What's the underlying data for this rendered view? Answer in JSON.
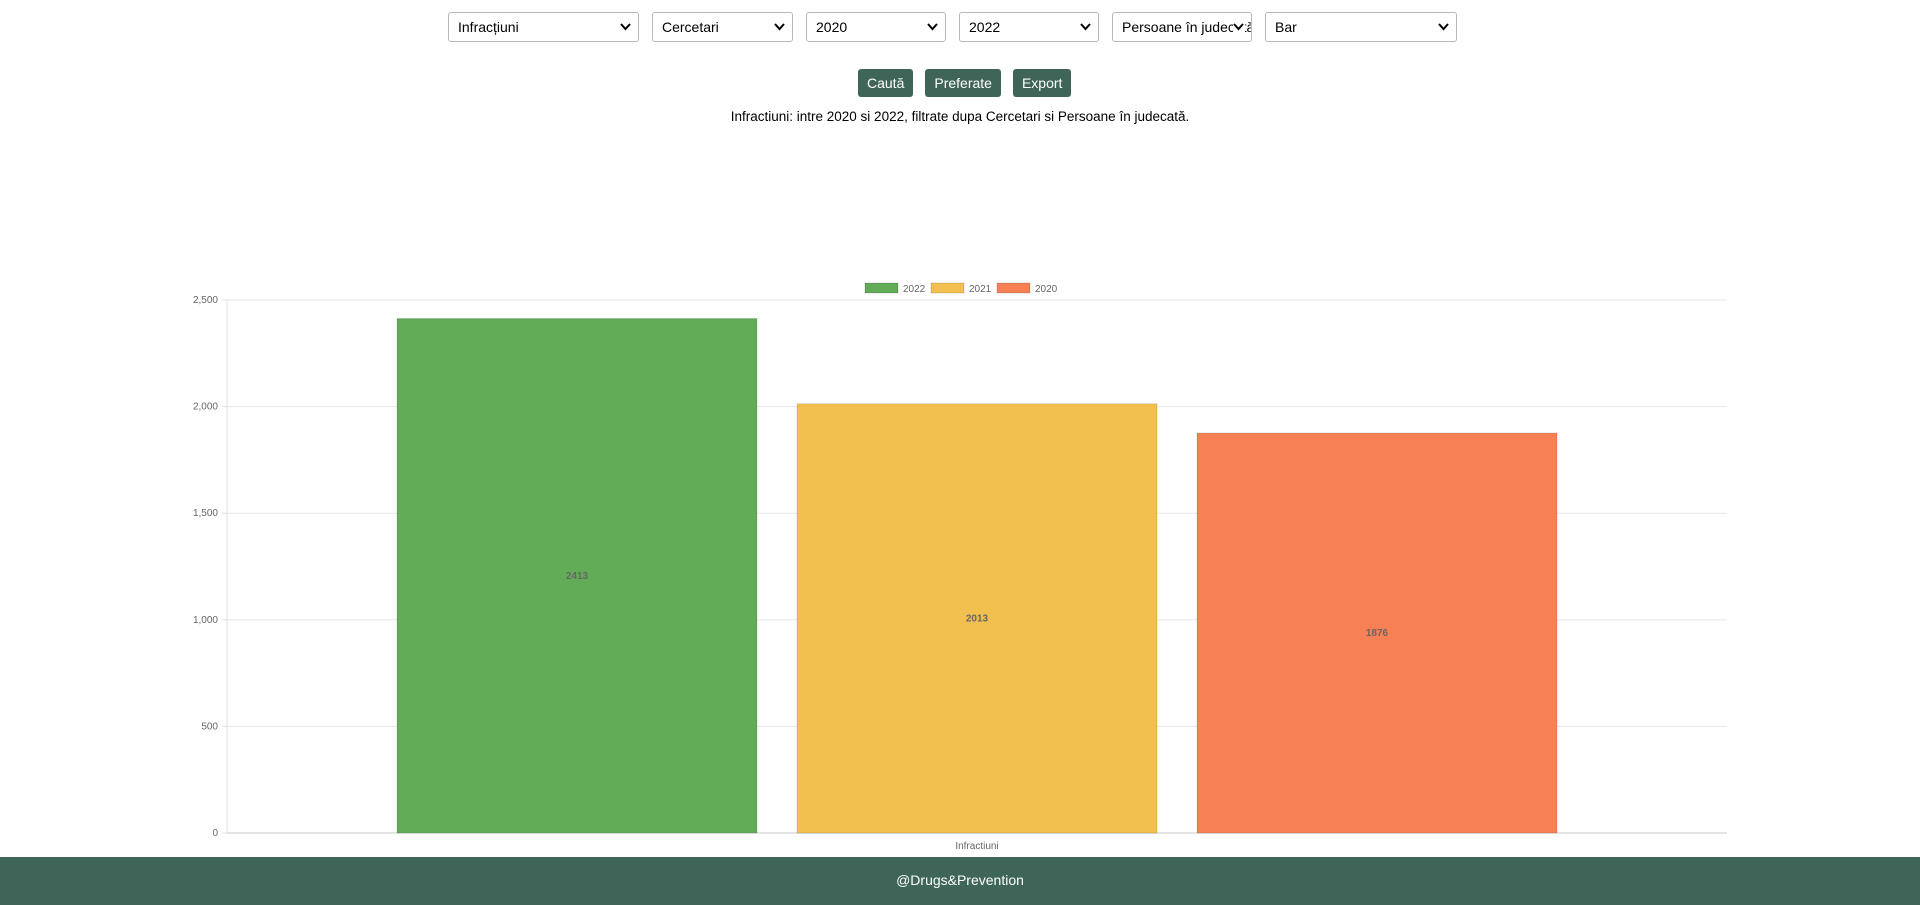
{
  "filters": {
    "category": "Infracțiuni",
    "stage": "Cercetari",
    "year_from": "2020",
    "year_to": "2022",
    "subject": "Persoane în judecată",
    "chart_type": "Bar"
  },
  "buttons": {
    "search": "Caută",
    "favorites": "Preferate",
    "export": "Export"
  },
  "caption": "Infractiuni: intre 2020 si 2022, filtrate dupa Cercetari si Persoane în judecată.",
  "footer": "@Drugs&Prevention",
  "chart_data": {
    "type": "bar",
    "categories": [
      "Infractiuni"
    ],
    "series": [
      {
        "name": "2022",
        "values": [
          2413
        ],
        "color": "#62ac57"
      },
      {
        "name": "2021",
        "values": [
          2013
        ],
        "color": "#f2c04f"
      },
      {
        "name": "2020",
        "values": [
          1876
        ],
        "color": "#f78155"
      }
    ],
    "ylim": [
      0,
      2500
    ],
    "yticks": [
      "0",
      "500",
      "1,000",
      "1,500",
      "2,000",
      "2,500"
    ],
    "grid": true,
    "legend": "top-center",
    "data_labels": true
  }
}
